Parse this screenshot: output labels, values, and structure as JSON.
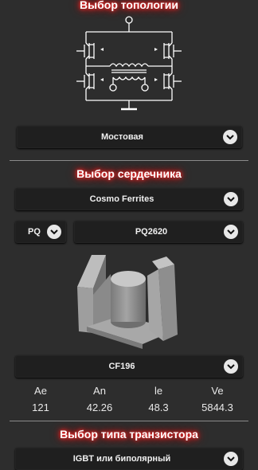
{
  "topology": {
    "title": "Выбор топологии",
    "select_value": "Мостовая"
  },
  "core": {
    "title": "Выбор сердечника",
    "manufacturer": "Cosmo Ferrites",
    "shape": "PQ",
    "size": "PQ2620",
    "material": "CF196",
    "params": [
      {
        "name": "Ae",
        "value": "121"
      },
      {
        "name": "An",
        "value": "42.26"
      },
      {
        "name": "le",
        "value": "48.3"
      },
      {
        "name": "Ve",
        "value": "5844.3"
      }
    ]
  },
  "transistor": {
    "title": "Выбор типа транзистора",
    "select_value": "IGBT или биполярный"
  },
  "icons": {
    "dropdown": "chevron-down-icon",
    "schematic": "bridge-topology-schematic",
    "core_image": "pq-ferrite-core-3d"
  },
  "colors": {
    "title_glow": "#ff2a2a",
    "background": "#2d2d2d",
    "control": "#1f1f1f"
  }
}
